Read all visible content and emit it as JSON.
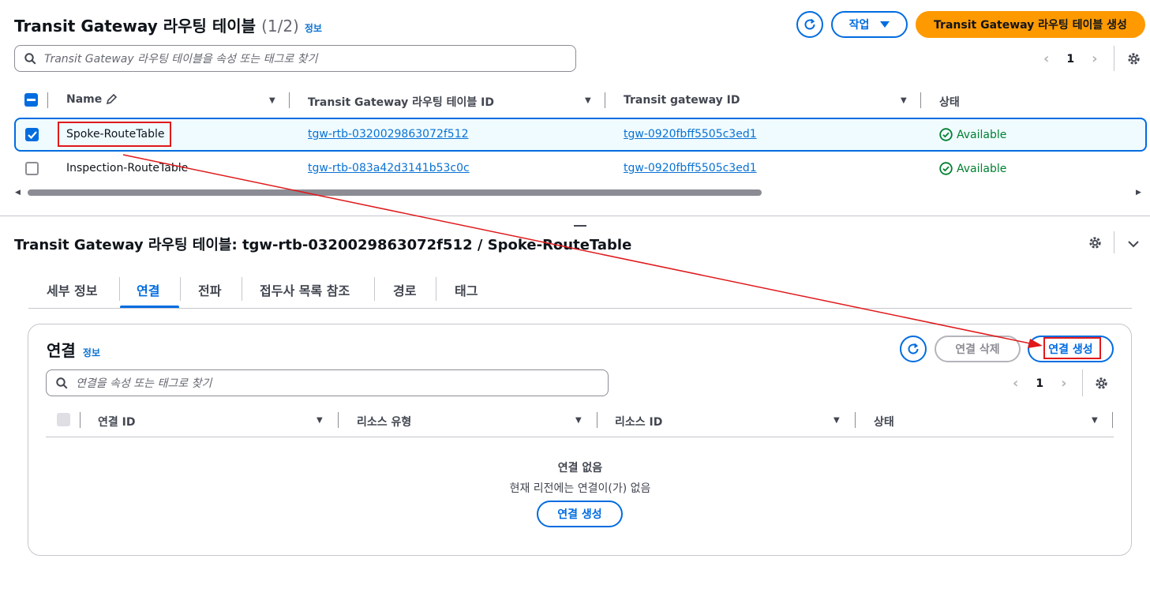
{
  "top": {
    "title": "Transit Gateway 라우팅 테이블",
    "count": "(1/2)",
    "info": "정보",
    "actions_label": "작업",
    "create_label": "Transit Gateway 라우팅 테이블 생성",
    "search_placeholder": "Transit Gateway 라우팅 테이블을 속성 또는 태그로 찾기",
    "page": "1",
    "columns": [
      "Name",
      "Transit Gateway 라우팅 테이블 ID",
      "Transit gateway ID",
      "상태"
    ],
    "rows": [
      {
        "name": "Spoke-RouteTable",
        "rtb_id": "tgw-rtb-0320029863072f512",
        "tgw_id": "tgw-0920fbff5505c3ed1",
        "status": "Available",
        "selected": true
      },
      {
        "name": "Inspection-RouteTable",
        "rtb_id": "tgw-rtb-083a42d3141b53c0c",
        "tgw_id": "tgw-0920fbff5505c3ed1",
        "status": "Available",
        "selected": false
      }
    ]
  },
  "detail": {
    "title": "Transit Gateway 라우팅 테이블: tgw-rtb-0320029863072f512 / Spoke-RouteTable",
    "tabs": [
      "세부 정보",
      "연결",
      "전파",
      "접두사 목록 참조",
      "경로",
      "태그"
    ],
    "active_tab": "연결"
  },
  "assoc": {
    "title": "연결",
    "info": "정보",
    "delete_label": "연결 삭제",
    "create_label": "연결 생성",
    "search_placeholder": "연결을 속성 또는 태그로 찾기",
    "page": "1",
    "columns": [
      "연결 ID",
      "리소스 유형",
      "리소스 ID",
      "상태"
    ],
    "empty_title": "연결 없음",
    "empty_desc": "현재 리전에는 연결이(가) 없음",
    "empty_button": "연결 생성"
  },
  "colors": {
    "accent": "#006ce0",
    "primary": "#ff9900",
    "success": "#00802f",
    "annotation": "#e0191b"
  }
}
